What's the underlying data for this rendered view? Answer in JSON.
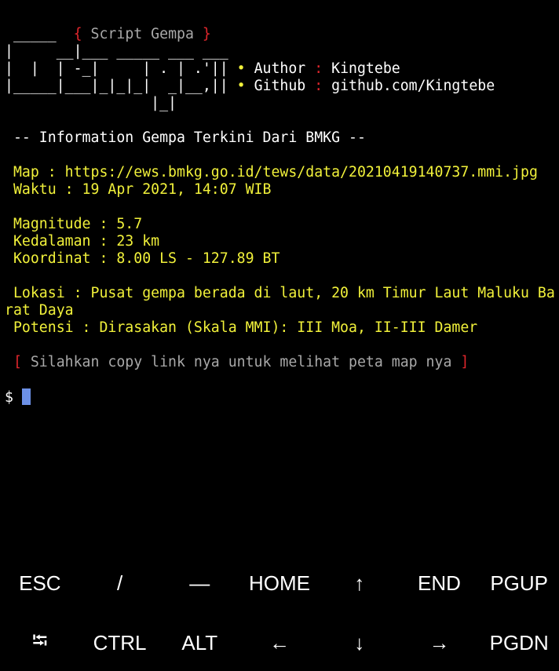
{
  "banner": {
    "line1_underscores": " _____  ",
    "line1_open": "{ ",
    "line1_title": "Script Gempa",
    "line1_close": " }",
    "art_line2": "|     __|___ _____ ___ ___",
    "art_line3": "|  |  | -_|     | . | .'|",
    "art_line4": "|_____|___|_|_|_|  _|__,|",
    "art_line5": "                 |_|",
    "author_label": "Author",
    "author_sep": ":",
    "author_value": "Kingtebe",
    "github_label": "Github",
    "github_sep": ":",
    "github_value": "github.com/Kingtebe",
    "bullet": "•"
  },
  "header_line": " -- Information Gempa Terkini Dari BMKG --",
  "info": {
    "map": " Map : https://ews.bmkg.go.id/tews/data/20210419140737.mmi.jpg",
    "waktu": " Waktu : 19 Apr 2021, 14:07 WIB",
    "magnitude": " Magnitude : 5.7",
    "kedalaman": " Kedalaman : 23 km",
    "koordinat": " Koordinat : 8.00 LS - 127.89 BT",
    "lokasi_1": " Lokasi : Pusat gempa berada di laut, 20 km Timur Laut Maluku Ba",
    "lokasi_2": "rat Daya",
    "potensi": " Potensi : Dirasakan (Skala MMI): III Moa, II-III Damer"
  },
  "notice": {
    "open": " [",
    "text": " Silahkan copy link nya untuk melihat peta map nya ",
    "close": "]"
  },
  "prompt": "$ ",
  "extra_keys": {
    "row1": [
      "ESC",
      "/",
      "—",
      "HOME",
      "↑",
      "END",
      "PGUP"
    ],
    "row2": [
      "⭾",
      "CTRL",
      "ALT",
      "←",
      "↓",
      "→",
      "PGDN"
    ]
  }
}
